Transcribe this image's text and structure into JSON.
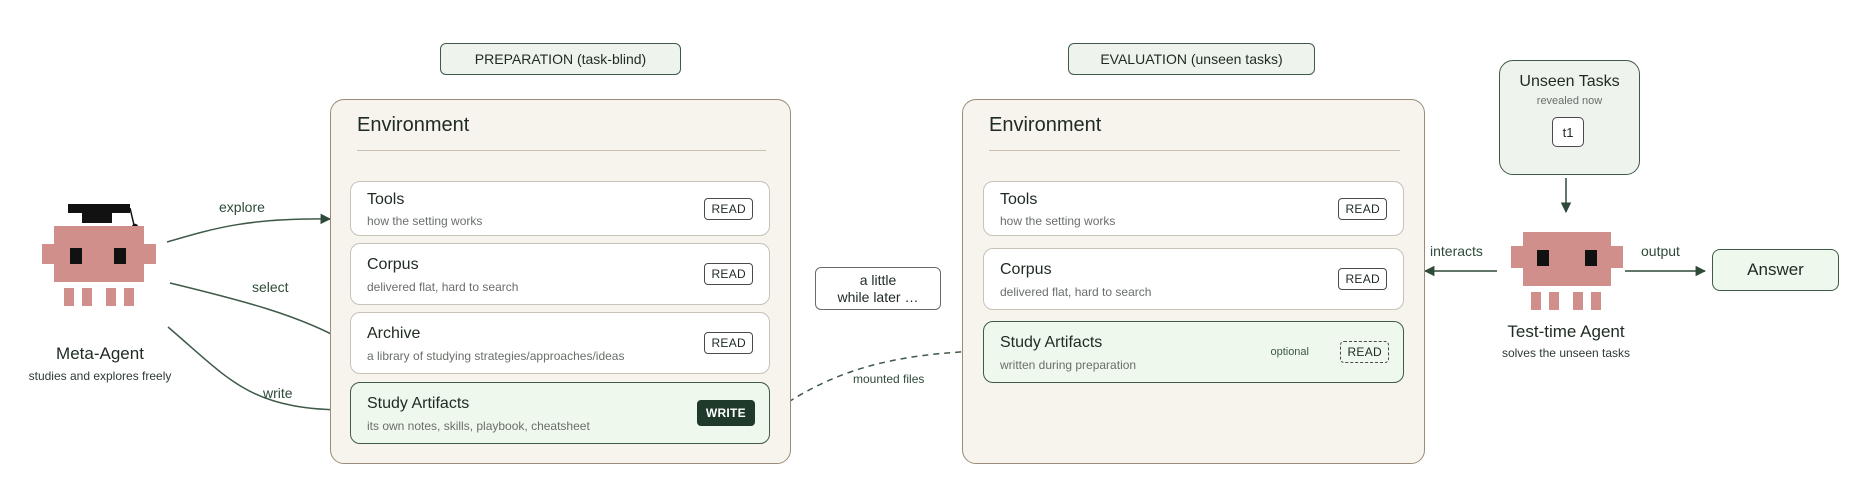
{
  "phases": {
    "preparation": "PREPARATION (task-blind)",
    "evaluation": "EVALUATION (unseen tasks)"
  },
  "prep_env": {
    "title": "Environment",
    "items": [
      {
        "title": "Tools",
        "desc": "how the setting works",
        "badge": "READ"
      },
      {
        "title": "Corpus",
        "desc": "delivered flat, hard to search",
        "badge": "READ"
      },
      {
        "title": "Archive",
        "desc": "a library of studying strategies/approaches/ideas",
        "badge": "READ"
      },
      {
        "title": "Study Artifacts",
        "desc": "its own notes, skills, playbook, cheatsheet",
        "badge": "WRITE"
      }
    ]
  },
  "eval_env": {
    "title": "Environment",
    "items": [
      {
        "title": "Tools",
        "desc": "how the setting works",
        "badge": "READ"
      },
      {
        "title": "Corpus",
        "desc": "delivered flat, hard to search",
        "badge": "READ"
      },
      {
        "title": "Study Artifacts",
        "desc": "written during preparation",
        "badge": "READ",
        "note": "optional"
      }
    ]
  },
  "edges": {
    "explore": "explore",
    "select": "select",
    "write": "write",
    "mounted": "mounted files",
    "interacts": "interacts",
    "output": "output"
  },
  "time_gap": {
    "line1": "a little",
    "line2": "while later …"
  },
  "meta_agent": {
    "name": "Meta-Agent",
    "desc": "studies and explores freely"
  },
  "test_agent": {
    "name": "Test-time Agent",
    "desc": "solves the unseen tasks"
  },
  "unseen_tasks": {
    "title": "Unseen Tasks",
    "sub": "revealed now",
    "chip": "t1"
  },
  "answer": "Answer",
  "colors": {
    "agent": "#d18f8c",
    "cap": "#111111",
    "edge": "#3f5a48",
    "panel_bg": "#f7f4ee",
    "green_bg": "#eef8ec"
  }
}
